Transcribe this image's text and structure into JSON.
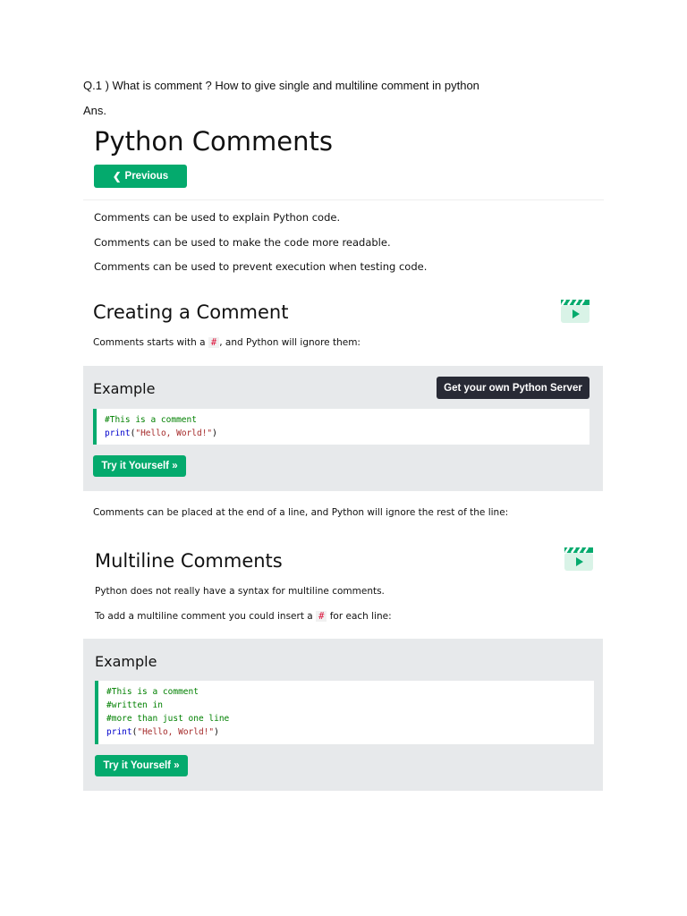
{
  "question": "Q.1 ) What is comment ? How to give single and multiline comment in python",
  "answer_label": "Ans.",
  "tutorial": {
    "title": "Python Comments",
    "previous_button": "Previous",
    "intro": [
      "Comments can be used to explain Python code.",
      "Comments can be used to make the code more readable.",
      "Comments can be used to prevent execution when testing code."
    ],
    "creating": {
      "heading": "Creating a Comment",
      "text_before": "Comments starts with a ",
      "hash": "#",
      "text_after": ", and Python will ignore them:",
      "example_title": "Example",
      "server_button": "Get your own Python Server",
      "code": {
        "comment": "#This is a comment",
        "func": "print",
        "open": "(",
        "string": "\"Hello, World!\"",
        "close": ")"
      },
      "try_button": "Try it Yourself »"
    },
    "end_of_line_text": "Comments can be placed at the end of a line, and Python will ignore the rest of the line:",
    "multiline": {
      "heading": "Multiline Comments",
      "p1": "Python does not really have a syntax for multiline comments.",
      "p2_before": "To add a multiline comment you could insert a ",
      "hash": "#",
      "p2_after": " for each line:",
      "example_title": "Example",
      "code": {
        "comments": [
          "#This is a comment",
          "#written in",
          "#more than just one line"
        ],
        "func": "print",
        "open": "(",
        "string": "\"Hello, World!\"",
        "close": ")"
      },
      "try_button": "Try it Yourself »"
    }
  },
  "colors": {
    "accent": "#04AA6D",
    "dark_button": "#282A35",
    "example_bg": "#E7E9EB"
  }
}
